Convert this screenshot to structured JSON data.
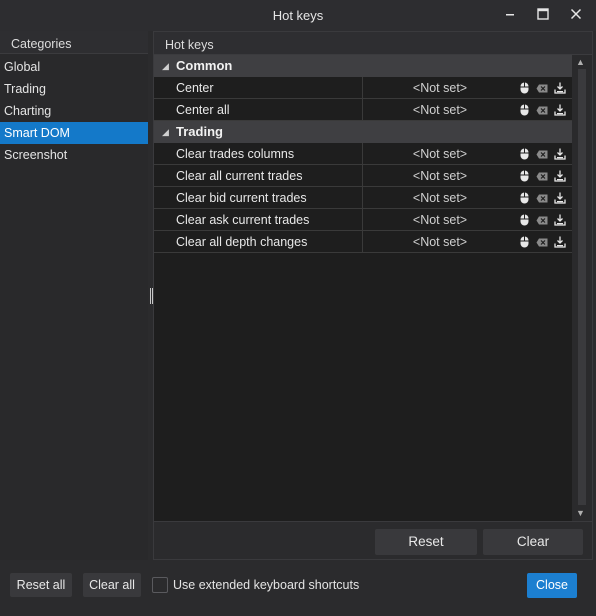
{
  "window": {
    "title": "Hot keys"
  },
  "categories": {
    "header": "Categories",
    "items": [
      {
        "label": "Global",
        "selected": false
      },
      {
        "label": "Trading",
        "selected": false
      },
      {
        "label": "Charting",
        "selected": false
      },
      {
        "label": "Smart DOM",
        "selected": true
      },
      {
        "label": "Screenshot",
        "selected": false
      }
    ]
  },
  "hotkeys": {
    "header": "Hot keys",
    "groups": [
      {
        "name": "Common",
        "rows": [
          {
            "name": "Center",
            "value": "<Not set>"
          },
          {
            "name": "Center all",
            "value": "<Not set>"
          }
        ]
      },
      {
        "name": "Trading",
        "rows": [
          {
            "name": "Clear trades columns",
            "value": "<Not set>"
          },
          {
            "name": "Clear all current trades",
            "value": "<Not set>"
          },
          {
            "name": "Clear bid current trades",
            "value": "<Not set>"
          },
          {
            "name": "Clear ask current trades",
            "value": "<Not set>"
          },
          {
            "name": "Clear all depth changes",
            "value": "<Not set>"
          }
        ]
      }
    ],
    "row_icons": [
      "mouse-icon",
      "clear-key-icon",
      "record-key-icon"
    ],
    "reset_label": "Reset",
    "clear_label": "Clear"
  },
  "footer": {
    "reset_all_label": "Reset all",
    "clear_all_label": "Clear all",
    "extended_shortcuts_label": "Use extended keyboard shortcuts",
    "extended_shortcuts_checked": false,
    "close_label": "Close"
  },
  "colors": {
    "accent": "#1479c9",
    "background": "#2b2b2d",
    "grid_background": "#1e1e1e",
    "group_row": "#3f3f42"
  }
}
